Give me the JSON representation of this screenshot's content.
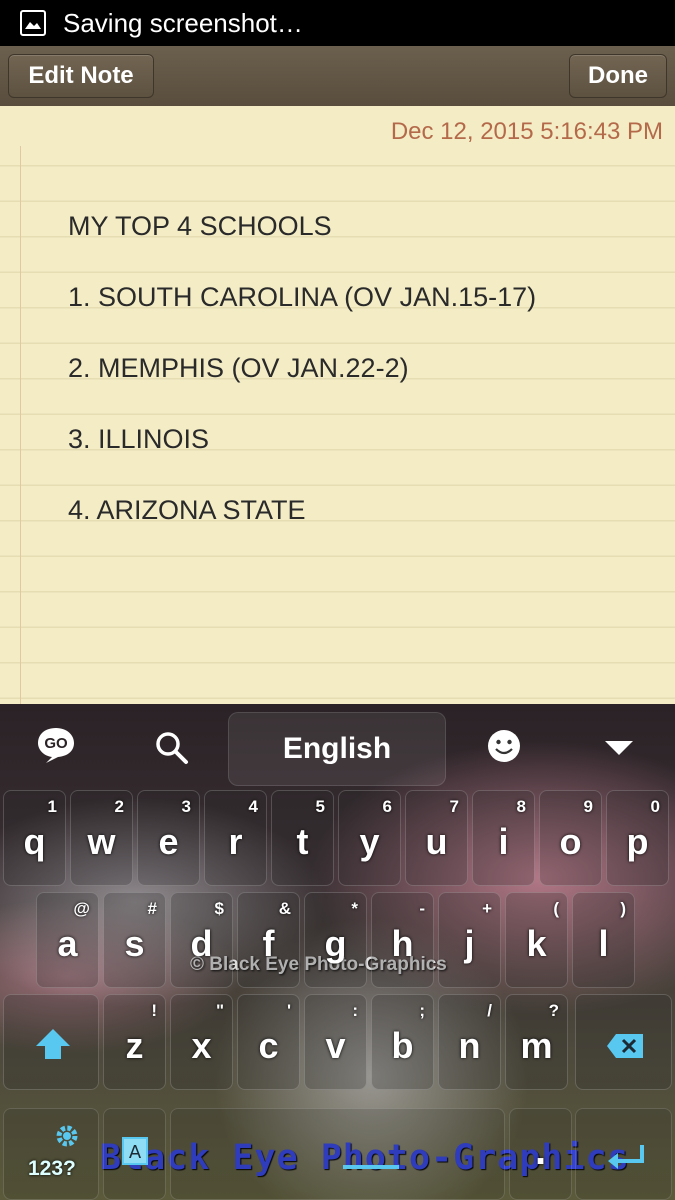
{
  "status_bar": {
    "icon": "image-icon",
    "text": "Saving screenshot…"
  },
  "action_bar": {
    "edit_label": "Edit Note",
    "done_label": "Done"
  },
  "note": {
    "date": "Dec 12, 2015 5:16:43 PM",
    "lines": [
      "MY TOP 4 SCHOOLS",
      "1. SOUTH CAROLINA (OV JAN.15-17)",
      "2. MEMPHIS (OV JAN.22-2)",
      "3. ILLINOIS",
      "4. ARIZONA STATE"
    ]
  },
  "keyboard": {
    "go_label": "GO",
    "language": "English",
    "rows": [
      [
        {
          "k": "q",
          "s": "1"
        },
        {
          "k": "w",
          "s": "2"
        },
        {
          "k": "e",
          "s": "3"
        },
        {
          "k": "r",
          "s": "4"
        },
        {
          "k": "t",
          "s": "5"
        },
        {
          "k": "y",
          "s": "6"
        },
        {
          "k": "u",
          "s": "7"
        },
        {
          "k": "i",
          "s": "8"
        },
        {
          "k": "o",
          "s": "9"
        },
        {
          "k": "p",
          "s": "0"
        }
      ],
      [
        {
          "k": "a",
          "s": "@"
        },
        {
          "k": "s",
          "s": "#"
        },
        {
          "k": "d",
          "s": "$"
        },
        {
          "k": "f",
          "s": "&"
        },
        {
          "k": "g",
          "s": "*"
        },
        {
          "k": "h",
          "s": "-"
        },
        {
          "k": "j",
          "s": "+"
        },
        {
          "k": "k",
          "s": "("
        },
        {
          "k": "l",
          "s": ")"
        }
      ],
      [
        {
          "k": "z",
          "s": "!"
        },
        {
          "k": "x",
          "s": "\""
        },
        {
          "k": "c",
          "s": "'"
        },
        {
          "k": "v",
          "s": ":"
        },
        {
          "k": "b",
          "s": ";"
        },
        {
          "k": "n",
          "s": "/"
        },
        {
          "k": "m",
          "s": "?"
        }
      ]
    ],
    "numeric_label": "123?",
    "period_label": ".",
    "watermark": "© Black Eye Photo-Graphics",
    "brand": "Black Eye Photo-Graphics",
    "colors": {
      "brand": "#3342d8",
      "backspace": "#58c8f0",
      "shift": "#58c8f0"
    }
  }
}
